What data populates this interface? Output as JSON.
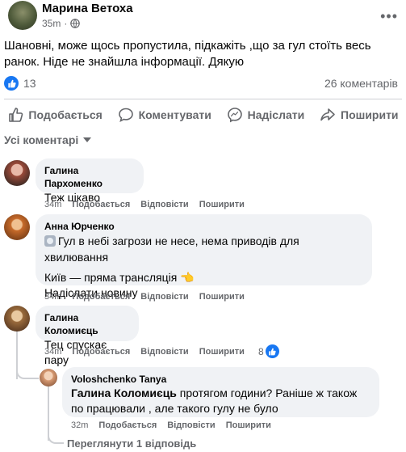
{
  "post": {
    "author": "Марина Ветоха",
    "time": "35m",
    "text": "Шановні, може щось пропустила, підкажіть ,що за гул стоїть весь ранок. Ніде не знайшла інформації. Дякую",
    "likes": "13",
    "comments_count": "26 коментарів",
    "more_icon": "more-dots-icon"
  },
  "actions": [
    {
      "label": "Подобається",
      "icon": "thumb-up-icon"
    },
    {
      "label": "Коментувати",
      "icon": "comment-icon"
    },
    {
      "label": "Надіслати",
      "icon": "messenger-icon"
    },
    {
      "label": "Поширити",
      "icon": "share-icon"
    }
  ],
  "sort": {
    "label": "Усі коментарі"
  },
  "comments": [
    {
      "name": "Галина Пархоменко",
      "text": "Теж цікаво",
      "time": "34m",
      "like": "Подобається",
      "reply": "Відповісти",
      "share": "Поширити"
    },
    {
      "name": "Анна Юрченко",
      "line1": "Гул в небі загрози не несе, нема приводів для хвилювання",
      "line2": "Київ — пряма трансляція",
      "line3": "Надіслати новину",
      "time": "34m",
      "like": "Подобається",
      "reply": "Відповісти",
      "share": "Поширити"
    },
    {
      "name": "Галина Коломиєць",
      "text": "Тец спускає пару",
      "time": "34m",
      "like": "Подобається",
      "reply": "Відповісти",
      "share": "Поширити",
      "reactions": "8"
    }
  ],
  "reply": {
    "name": "Voloshchenko Tanya",
    "mention": "Галина Коломиєць",
    "text": " протягом години? Раніше ж також по працювали , але такого гулу не було",
    "time": "32m",
    "like": "Подобається",
    "reply": "Відповісти",
    "share": "Поширити"
  },
  "view_replies": "Переглянути 1 відповідь",
  "colors": {
    "accent": "#1877f2",
    "muted": "#65676b",
    "bubble": "#f0f2f5"
  }
}
